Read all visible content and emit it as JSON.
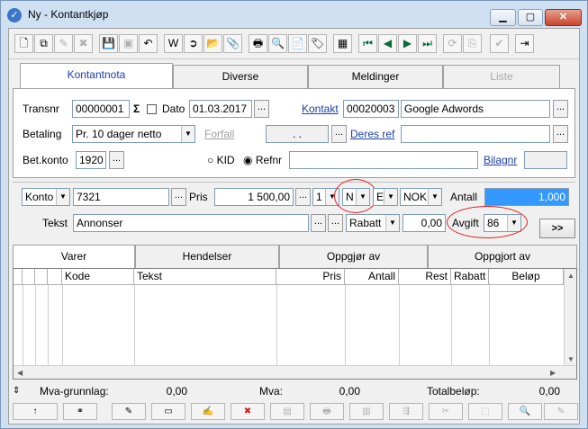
{
  "window": {
    "title": "Ny - Kontantkjøp",
    "icon": "check-icon",
    "minimize": "▁",
    "maximize": "▢",
    "close": "✕"
  },
  "toolbar": {
    "icons": [
      "new-document-icon",
      "copy-document-icon",
      "edit-document-icon",
      "delete-document-icon",
      "save-icon",
      "save-copy-icon",
      "undo-icon",
      "word-icon",
      "export-icon",
      "open-folder-icon",
      "attach-icon",
      "print-icon",
      "print-preview-icon",
      "print-document-icon",
      "tag-icon",
      "calculator-icon",
      "first-record-icon",
      "previous-record-icon",
      "next-record-icon",
      "last-record-icon",
      "refresh-icon",
      "copy-icon",
      "clipboard-check-icon",
      "exit-icon"
    ],
    "glyphs": [
      "🗋",
      "⧉",
      "✎",
      "✖",
      "💾",
      "▣",
      "↶",
      "W",
      "➲",
      "📂",
      "📎",
      "🖶",
      "🔍",
      "📄",
      "🏷",
      "▦",
      "⏮",
      "◀",
      "▶",
      "⏭",
      "⟳",
      "⎘",
      "✔",
      "⇥"
    ]
  },
  "main_tabs": [
    {
      "label": "Kontantnota",
      "state": "active"
    },
    {
      "label": "Diverse",
      "state": "normal"
    },
    {
      "label": "Meldinger",
      "state": "normal"
    },
    {
      "label": "Liste",
      "state": "disabled"
    }
  ],
  "header": {
    "transnr_label": "Transnr",
    "transnr_value": "00000001",
    "sigma": "Σ",
    "dato_label": "Dato",
    "dato_value": "01.03.2017",
    "kontakt_label": "Kontakt",
    "kontakt_id": "00020003",
    "kontakt_name": "Google Adwords",
    "betaling_label": "Betaling",
    "betaling_value": "Pr. 10 dager netto",
    "forfall_label": "Forfall",
    "forfall_value": ". .",
    "deres_ref_label": "Deres ref",
    "deres_ref_value": "",
    "betkonto_label": "Bet.konto",
    "betkonto_value": "1920",
    "kid_label": "KID",
    "refnr_label": "Refnr",
    "refnr_value": "",
    "bilagnr_label": "Bilagnr",
    "bilagnr_value": "",
    "dots": "..."
  },
  "line": {
    "konto_type": "Konto",
    "konto_value": "7321",
    "pris_label": "Pris",
    "pris_value": "1 500,00",
    "qty_select": "1",
    "n_select": "N",
    "e_select": "E",
    "currency": "NOK",
    "antall_label": "Antall",
    "antall_value": "1,000",
    "tekst_label": "Tekst",
    "tekst_value": "Annonser",
    "rabatt_select": "Rabatt",
    "rabatt_value": "0,00",
    "avgift_label": "Avgift",
    "avgift_value": "86",
    "more_button": ">>",
    "arrow": "▼"
  },
  "sub_tabs": [
    "Varer",
    "Hendelser",
    "Oppgjør av",
    "Oppgjort av"
  ],
  "grid": {
    "columns": [
      "Kode",
      "Tekst",
      "Pris",
      "Antall",
      "Rest",
      "Rabatt",
      "Beløp"
    ]
  },
  "totals": {
    "mva_grunnlag_label": "Mva-grunnlag:",
    "mva_grunnlag_value": "0,00",
    "mva_label": "Mva:",
    "mva_value": "0,00",
    "total_label": "Totalbeløp:",
    "total_value": "0,00"
  },
  "bottom_toolbar": {
    "icons": [
      "up-icon",
      "link-icon",
      "edit-lines-icon",
      "window-icon",
      "notes-icon",
      "delete-line-icon",
      "layers-icon",
      "print-icon",
      "chart-icon",
      "transfer-icon",
      "tool-icon",
      "tray-icon",
      "search-icon",
      "edit-icon"
    ],
    "glyphs": [
      "↑",
      "⚭",
      "✎",
      "▭",
      "✍",
      "✖",
      "▤",
      "🖶",
      "▥",
      "⇶",
      "✂",
      "⬚",
      "🔍",
      "✎"
    ]
  }
}
